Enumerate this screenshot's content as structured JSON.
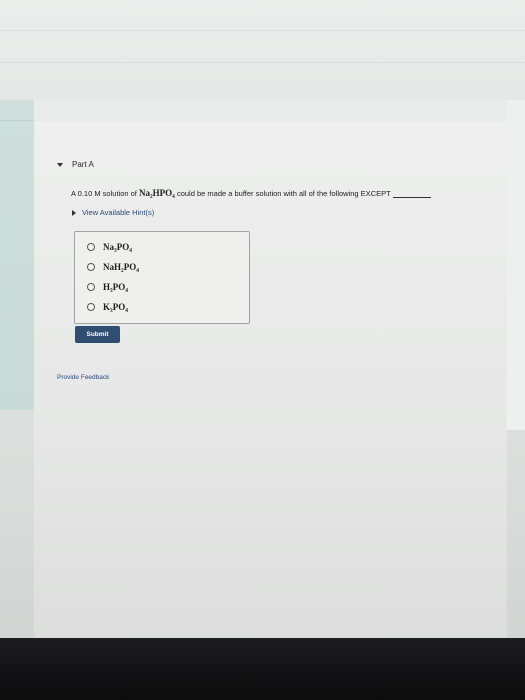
{
  "part": {
    "title": "Part A"
  },
  "question": {
    "prefix": "A 0.10 M solution of ",
    "chemical": "Na₂HPO₄",
    "suffix": " could be made a buffer solution with all of the following EXCEPT"
  },
  "hints": {
    "label": "View Available Hint(s)"
  },
  "options": [
    {
      "label": "Na₃PO₄"
    },
    {
      "label": "NaH₂PO₄"
    },
    {
      "label": "H₃PO₄"
    },
    {
      "label": "K₃PO₄"
    }
  ],
  "submit": {
    "label": "Submit"
  },
  "feedback": {
    "label": "Provide Feedback"
  },
  "colors": {
    "submit_bg": "#2f4e72",
    "link": "#2a4a7a"
  }
}
